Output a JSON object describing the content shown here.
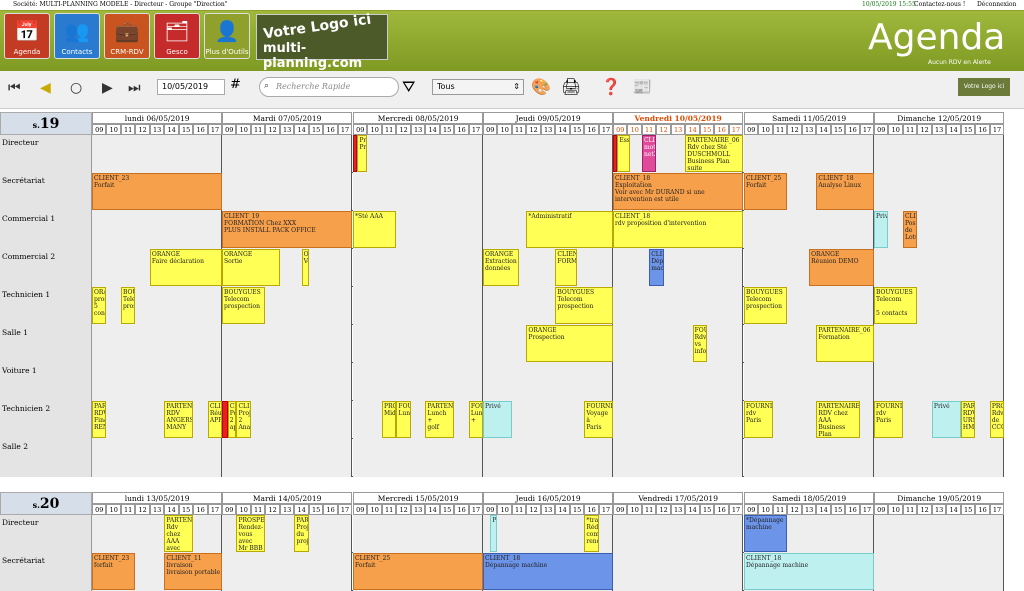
{
  "header": {
    "title_text": "Société: MULTI-PLANNING MODELE -  Directeur - Groupe \"Direction\"",
    "datetime": "10/05/2019 15:55",
    "contact": "Contactez-nous !",
    "logout": "Déconnexion"
  },
  "modules": [
    {
      "label": "Agenda",
      "icon": "calendar-icon",
      "glyph": "📅",
      "color": "#c23b22"
    },
    {
      "label": "Contacts",
      "icon": "people-icon",
      "glyph": "👥",
      "color": "#2a7bd0"
    },
    {
      "label": "CRM-RDV",
      "icon": "crm-icon",
      "glyph": "💼",
      "color": "#c9541f"
    },
    {
      "label": "Gesco",
      "icon": "briefcase-icon",
      "glyph": "🗂",
      "color": "#c62b2b"
    },
    {
      "label": "Plus d'Outils",
      "icon": "tools-icon",
      "glyph": "👤",
      "color": "#8fa12c"
    }
  ],
  "logo": {
    "line1": "Votre Logo ici",
    "line2": "multi-planning.com"
  },
  "app_title": "Agenda",
  "alert_text": "Aucun RDV en Alerte",
  "toolbar": {
    "date_value": "10/05/2019",
    "search_placeholder": "Recherche Rapide",
    "filter_value": "Tous"
  },
  "minilogo": "Votre Logo ici",
  "hours": [
    "09",
    "10",
    "11",
    "12",
    "13",
    "14",
    "15",
    "16",
    "17"
  ],
  "weeks": [
    {
      "label": "19",
      "days": [
        {
          "label": "lundi 06/05/2019",
          "today": false
        },
        {
          "label": "Mardi 07/05/2019",
          "today": false
        },
        {
          "label": "Mercredi 08/05/2019",
          "today": false
        },
        {
          "label": "Jeudi 09/05/2019",
          "today": false
        },
        {
          "label": "Vendredi 10/05/2019",
          "today": true
        },
        {
          "label": "Samedi 11/05/2019",
          "today": false
        },
        {
          "label": "Dimanche 12/05/2019",
          "today": false
        }
      ],
      "rows": [
        "Directeur",
        "Secrétariat",
        "Commercial 1",
        "Commercial 2",
        "Technicien 1",
        "Salle  1",
        "Voiture 1",
        "Technicien 2",
        "Salle 2"
      ]
    },
    {
      "label": "20",
      "days": [
        {
          "label": "lundi 13/05/2019",
          "today": false
        },
        {
          "label": "Mardi 14/05/2019",
          "today": false
        },
        {
          "label": "Mercredi 15/05/2019",
          "today": false
        },
        {
          "label": "Jeudi 16/05/2019",
          "today": false
        },
        {
          "label": "Vendredi 17/05/2019",
          "today": false
        },
        {
          "label": "Samedi 18/05/2019",
          "today": false
        },
        {
          "label": "Dimanche 19/05/2019",
          "today": false
        }
      ],
      "rows": [
        "Directeur",
        "Secrétariat"
      ]
    }
  ],
  "events": [
    {
      "w": 0,
      "r": 0,
      "d": 2,
      "s": 0,
      "e": 0.3,
      "k": "r",
      "t": ""
    },
    {
      "w": 0,
      "r": 0,
      "d": 2,
      "s": 0.3,
      "e": 1.0,
      "k": "y",
      "t": "Privé\nPrivé"
    },
    {
      "w": 0,
      "r": 0,
      "d": 4,
      "s": 0,
      "e": 0.3,
      "k": "r",
      "t": ""
    },
    {
      "w": 0,
      "r": 0,
      "d": 4,
      "s": 0.3,
      "e": 1.2,
      "k": "y",
      "t": "Essai"
    },
    {
      "w": 0,
      "r": 0,
      "d": 4,
      "s": 2.0,
      "e": 3.0,
      "k": "p",
      "t": "CLIE\nmot\nnet2"
    },
    {
      "w": 0,
      "r": 0,
      "d": 4,
      "s": 5.0,
      "e": 9.0,
      "k": "y",
      "t": "PARTENAIRE_06\nRdv chez Sté\nDUSCHMOLL\nBusiness Plan suite\nétude de marché"
    },
    {
      "w": 0,
      "r": 1,
      "d": 0,
      "s": 0,
      "e": 9,
      "k": "o",
      "t": "CLIENT_23\nForfait"
    },
    {
      "w": 0,
      "r": 1,
      "d": 4,
      "s": 0,
      "e": 9,
      "k": "o",
      "t": "CLIENT_18\nExploitation\nVoir avec Mr DURAND si une intervention est utile"
    },
    {
      "w": 0,
      "r": 1,
      "d": 5,
      "s": 0,
      "e": 3,
      "k": "o",
      "t": "CLIENT_25\nForfait"
    },
    {
      "w": 0,
      "r": 1,
      "d": 5,
      "s": 5,
      "e": 9,
      "k": "o",
      "t": "CLIENT_18\nAnalyse Linux"
    },
    {
      "w": 0,
      "r": 2,
      "d": 1,
      "s": 0,
      "e": 9,
      "k": "o",
      "t": "CLIENT_19\nFORMATION Chez XXX\nPLUS INSTALL PACK OFFICE"
    },
    {
      "w": 0,
      "r": 2,
      "d": 2,
      "s": 0,
      "e": 3,
      "k": "y",
      "t": "*Sté AAA"
    },
    {
      "w": 0,
      "r": 2,
      "d": 3,
      "s": 3,
      "e": 9,
      "k": "y",
      "t": "*Administratif"
    },
    {
      "w": 0,
      "r": 2,
      "d": 4,
      "s": 0,
      "e": 9,
      "k": "y",
      "t": "CLIENT_18\nrdv proposition d'intervention"
    },
    {
      "w": 0,
      "r": 2,
      "d": 6,
      "s": 0,
      "e": 1,
      "k": "c",
      "t": "Privé"
    },
    {
      "w": 0,
      "r": 2,
      "d": 6,
      "s": 2,
      "e": 3,
      "k": "o",
      "t": "CLIE\nPoste\nde\nLotu"
    },
    {
      "w": 0,
      "r": 3,
      "d": 0,
      "s": 4,
      "e": 9,
      "k": "y",
      "t": "ORANGE\nFaire déclaration"
    },
    {
      "w": 0,
      "r": 3,
      "d": 1,
      "s": 0,
      "e": 4,
      "k": "y",
      "t": "ORANGE\nSortie"
    },
    {
      "w": 0,
      "r": 3,
      "d": 1,
      "s": 5.5,
      "e": 6,
      "k": "y",
      "t": "OR\nVé"
    },
    {
      "w": 0,
      "r": 3,
      "d": 3,
      "s": 0,
      "e": 2.5,
      "k": "y",
      "t": "ORANGE\nExtraction\ndonnées"
    },
    {
      "w": 0,
      "r": 3,
      "d": 3,
      "s": 5,
      "e": 6.5,
      "k": "y",
      "t": "CLIENT\nFORMA"
    },
    {
      "w": 0,
      "r": 3,
      "d": 4,
      "s": 2.5,
      "e": 3.5,
      "k": "b",
      "t": "CLIE\nDép\nmach"
    },
    {
      "w": 0,
      "r": 3,
      "d": 5,
      "s": 4.5,
      "e": 9,
      "k": "o",
      "t": "ORANGE\nRéunion DEMO"
    },
    {
      "w": 0,
      "r": 4,
      "d": 0,
      "s": 0,
      "e": 1,
      "k": "y",
      "t": "ORA\nprosp\n5\ncont"
    },
    {
      "w": 0,
      "r": 4,
      "d": 0,
      "s": 2,
      "e": 3,
      "k": "y",
      "t": "BOU\nTelec\nprosp"
    },
    {
      "w": 0,
      "r": 4,
      "d": 1,
      "s": 0,
      "e": 3,
      "k": "y",
      "t": "BOUYGUES\nTelecom\nprospection"
    },
    {
      "w": 0,
      "r": 4,
      "d": 3,
      "s": 5,
      "e": 9,
      "k": "y",
      "t": "BOUYGUES Telecom\nprospection"
    },
    {
      "w": 0,
      "r": 4,
      "d": 5,
      "s": 0,
      "e": 3,
      "k": "y",
      "t": "BOUYGUES\nTelecom\nprospection"
    },
    {
      "w": 0,
      "r": 4,
      "d": 6,
      "s": 0,
      "e": 3,
      "k": "y",
      "t": "BOUYGUES\nTelecom\n\n5 contacts"
    },
    {
      "w": 0,
      "r": 5,
      "d": 3,
      "s": 3,
      "e": 9,
      "k": "y",
      "t": "ORANGE\nProspection"
    },
    {
      "w": 0,
      "r": 5,
      "d": 4,
      "s": 5.5,
      "e": 6.5,
      "k": "y",
      "t": "FOU\nRdv\nvs\ninfor"
    },
    {
      "w": 0,
      "r": 5,
      "d": 5,
      "s": 5,
      "e": 9,
      "k": "y",
      "t": "PARTENAIRE_06\nFormation"
    },
    {
      "w": 0,
      "r": 7,
      "d": 0,
      "s": 0,
      "e": 1,
      "k": "y",
      "t": "PART\nRDV\nFinal\nREN"
    },
    {
      "w": 0,
      "r": 7,
      "d": 0,
      "s": 5,
      "e": 7,
      "k": "y",
      "t": "PARTENA\nRDV\nANGERS\nMANY"
    },
    {
      "w": 0,
      "r": 7,
      "d": 0,
      "s": 8,
      "e": 9,
      "k": "y",
      "t": "CLIE\nRéu\nAPPE"
    },
    {
      "w": 0,
      "r": 7,
      "d": 1,
      "s": 0,
      "e": 0.4,
      "k": "r",
      "t": ""
    },
    {
      "w": 0,
      "r": 7,
      "d": 1,
      "s": 0.4,
      "e": 1,
      "k": "y",
      "t": "CLIE\nPoin\n2\nappe"
    },
    {
      "w": 0,
      "r": 7,
      "d": 1,
      "s": 1,
      "e": 2,
      "k": "y",
      "t": "CLIE\nProje\n2\nAnal"
    },
    {
      "w": 0,
      "r": 7,
      "d": 2,
      "s": 2,
      "e": 3,
      "k": "y",
      "t": "PRO\nMidi"
    },
    {
      "w": 0,
      "r": 7,
      "d": 2,
      "s": 3,
      "e": 4,
      "k": "y",
      "t": "FOU\nLunc"
    },
    {
      "w": 0,
      "r": 7,
      "d": 2,
      "s": 5,
      "e": 7,
      "k": "y",
      "t": "PARTENA\nLunch +\ngolf"
    },
    {
      "w": 0,
      "r": 7,
      "d": 2,
      "s": 8,
      "e": 9,
      "k": "y",
      "t": "FOUR\nLunch\n+"
    },
    {
      "w": 0,
      "r": 7,
      "d": 3,
      "s": 0,
      "e": 2,
      "k": "c",
      "t": "Privé"
    },
    {
      "w": 0,
      "r": 7,
      "d": 3,
      "s": 7,
      "e": 9,
      "k": "y",
      "t": "FOURNISS\nVoyage à\nParis"
    },
    {
      "w": 0,
      "r": 7,
      "d": 5,
      "s": 0,
      "e": 2,
      "k": "y",
      "t": "FOURNIS\nrdv Paris"
    },
    {
      "w": 0,
      "r": 7,
      "d": 5,
      "s": 5,
      "e": 8,
      "k": "y",
      "t": "PARTENAIRE_0\nRDV chez AAA\nBusiness Plan\nMP suite étude"
    },
    {
      "w": 0,
      "r": 7,
      "d": 6,
      "s": 0,
      "e": 2,
      "k": "y",
      "t": "FOURNIS\nrdv Paris"
    },
    {
      "w": 0,
      "r": 7,
      "d": 6,
      "s": 4,
      "e": 6,
      "k": "c",
      "t": "Privé"
    },
    {
      "w": 0,
      "r": 7,
      "d": 6,
      "s": 6,
      "e": 7,
      "k": "y",
      "t": "PAR\nRDV\nURS\nHME"
    },
    {
      "w": 0,
      "r": 7,
      "d": 6,
      "s": 8,
      "e": 9,
      "k": "y",
      "t": "PRO\nRdv\nde\nCCC"
    },
    {
      "w": 1,
      "r": 0,
      "d": 0,
      "s": 5,
      "e": 7,
      "k": "y",
      "t": "PARTENA\nRdv chez\nAAA avec\nBBB"
    },
    {
      "w": 1,
      "r": 0,
      "d": 1,
      "s": 1,
      "e": 3,
      "k": "y",
      "t": "PROSPEC\nRendez-\nvous avec\nMr BBB"
    },
    {
      "w": 1,
      "r": 0,
      "d": 1,
      "s": 5,
      "e": 6,
      "k": "y",
      "t": "PART\nProjet\ndu\nproje"
    },
    {
      "w": 1,
      "r": 0,
      "d": 3,
      "s": 0.5,
      "e": 1,
      "k": "c",
      "t": "Pr"
    },
    {
      "w": 1,
      "r": 0,
      "d": 3,
      "s": 7,
      "e": 8,
      "k": "y",
      "t": "*trav\nRédi\ncomp\nrend"
    },
    {
      "w": 1,
      "r": 0,
      "d": 5,
      "s": 0,
      "e": 3,
      "k": "b",
      "t": "*Dépannage\nmachine"
    },
    {
      "w": 1,
      "r": 1,
      "d": 0,
      "s": 0,
      "e": 3,
      "k": "o",
      "t": "CLIENT_23\nforfait"
    },
    {
      "w": 1,
      "r": 1,
      "d": 0,
      "s": 5,
      "e": 9,
      "k": "o",
      "t": "CLIENT_11\nlivraison\nlivraison portable"
    },
    {
      "w": 1,
      "r": 1,
      "d": 2,
      "s": 0,
      "e": 9,
      "k": "o",
      "t": "CLIENT_25\nForfait"
    },
    {
      "w": 1,
      "r": 1,
      "d": 3,
      "s": 0,
      "e": 9,
      "k": "b",
      "t": "CLIENT_18\nDépannage machine"
    },
    {
      "w": 1,
      "r": 1,
      "d": 5,
      "s": 0,
      "e": 9,
      "k": "c",
      "t": "CLIENT_18\nDépannage machine"
    }
  ]
}
